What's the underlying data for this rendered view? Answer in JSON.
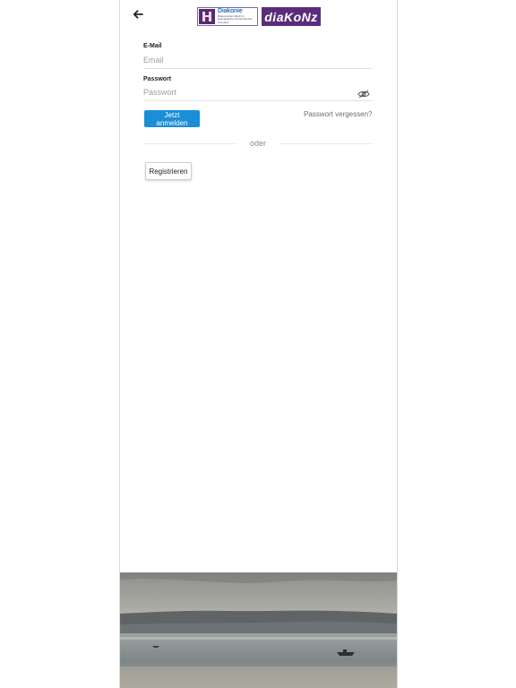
{
  "header": {
    "back_icon": "arrow-left-icon",
    "logo_primary": {
      "name": "Diakonie",
      "subtitle": "Diakonisches Werk im Evangelischen Kirchenbezirk Konstanz"
    },
    "logo_secondary": {
      "text": "diaKoNz"
    }
  },
  "form": {
    "email": {
      "label": "E-Mail",
      "placeholder": "Email",
      "value": ""
    },
    "password": {
      "label": "Passwort",
      "placeholder": "Passwort",
      "value": "",
      "toggle_icon": "eye-off-icon"
    },
    "login_label": "Jetzt anmelden",
    "forgot_label": "Passwort vergessen?",
    "separator_label": "oder",
    "register_label": "Registrieren"
  },
  "colors": {
    "primary": "#1a8fd6",
    "logo_purple": "#5a2d7a",
    "diakonie_blue": "#2b78c4"
  }
}
